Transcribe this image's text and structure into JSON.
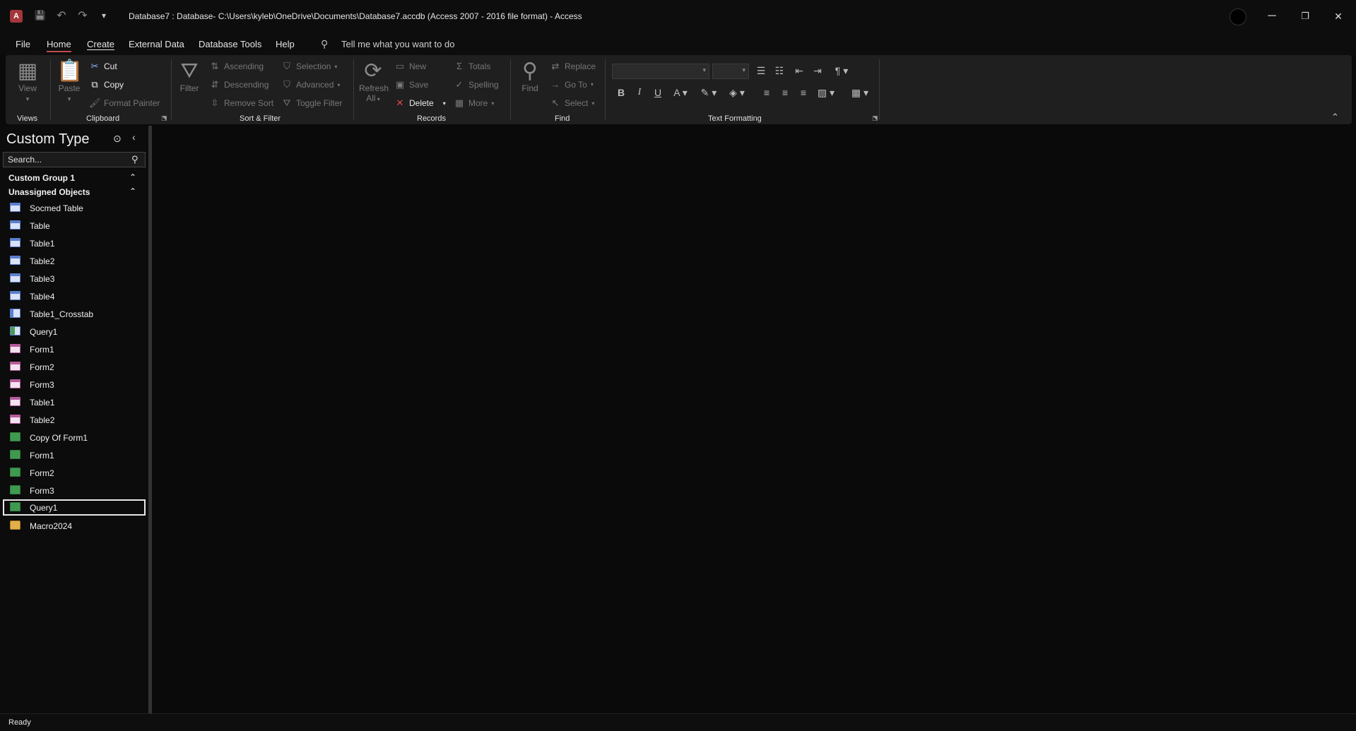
{
  "window": {
    "title": "Database7 : Database- C:\\Users\\kyleb\\OneDrive\\Documents\\Database7.accdb (Access 2007 - 2016 file format)  -  Access",
    "app_icon_letter": "A",
    "minimize": "─",
    "restore": "❐",
    "close": "✕"
  },
  "qat": {
    "save": "💾",
    "undo": "↶",
    "redo": "↷",
    "customize": "▾"
  },
  "menu": {
    "file": "File",
    "home": "Home",
    "create": "Create",
    "external_data": "External Data",
    "database_tools": "Database Tools",
    "help": "Help",
    "tell_me": "Tell me what you want to do"
  },
  "ribbon": {
    "views": {
      "label": "Views",
      "view": "View"
    },
    "clipboard": {
      "label": "Clipboard",
      "paste": "Paste",
      "cut": "Cut",
      "copy": "Copy",
      "format_painter": "Format Painter"
    },
    "sort_filter": {
      "label": "Sort & Filter",
      "filter": "Filter",
      "ascending": "Ascending",
      "descending": "Descending",
      "remove_sort": "Remove Sort",
      "selection": "Selection",
      "advanced": "Advanced",
      "toggle_filter": "Toggle Filter"
    },
    "records": {
      "label": "Records",
      "refresh": "Refresh",
      "refresh_all": "All",
      "new": "New",
      "save": "Save",
      "delete": "Delete",
      "totals": "Totals",
      "spelling": "Spelling",
      "more": "More"
    },
    "find": {
      "label": "Find",
      "find": "Find",
      "replace": "Replace",
      "goto": "Go To",
      "select": "Select"
    },
    "text_formatting": {
      "label": "Text Formatting"
    }
  },
  "nav": {
    "title": "Custom Type",
    "search_placeholder": "Search...",
    "groups": [
      {
        "label": "Custom Group 1"
      },
      {
        "label": "Unassigned Objects"
      }
    ],
    "items": [
      {
        "label": "Socmed Table"
      },
      {
        "label": "Table"
      },
      {
        "label": "Table1"
      },
      {
        "label": "Table2"
      },
      {
        "label": "Table3"
      },
      {
        "label": "Table4"
      },
      {
        "label": "Table1_Crosstab"
      },
      {
        "label": "Query1"
      },
      {
        "label": "Form1"
      },
      {
        "label": "Form2"
      },
      {
        "label": "Form3"
      },
      {
        "label": "Table1"
      },
      {
        "label": "Table2"
      },
      {
        "label": "Copy Of Form1"
      },
      {
        "label": "Form1"
      },
      {
        "label": "Form2"
      },
      {
        "label": "Form3"
      },
      {
        "label": "Query1"
      },
      {
        "label": "Macro2024"
      }
    ]
  },
  "status": {
    "text": "Ready"
  }
}
